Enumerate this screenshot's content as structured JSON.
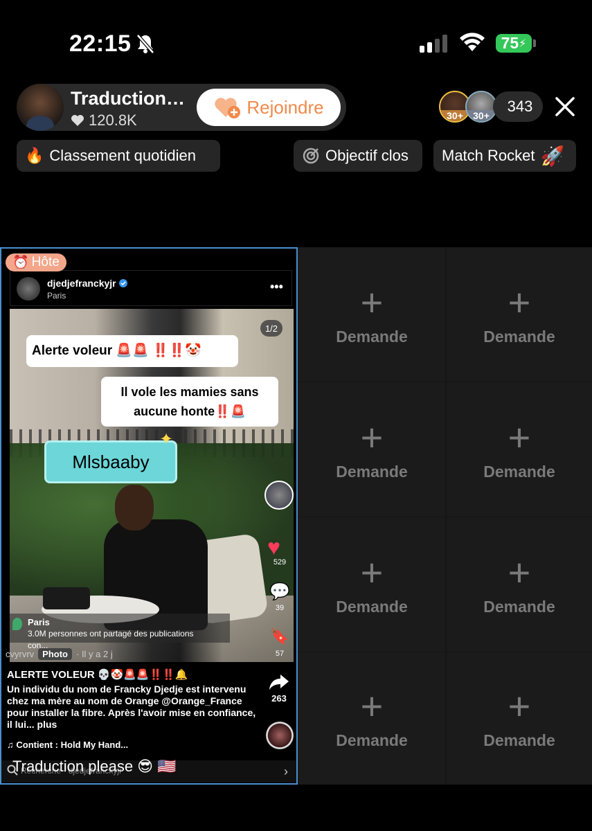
{
  "status": {
    "time": "22:15",
    "battery": "75"
  },
  "host": {
    "name": "Traduction…",
    "likes": "120.8K",
    "join_label": "Rejoindre"
  },
  "viewers": {
    "badge1": "30+",
    "badge2": "30+",
    "count": "343"
  },
  "chips": {
    "ranking": "Classement quotidien",
    "goal": "Objectif clos",
    "rocket": "Match Rocket"
  },
  "host_tile": {
    "badge": "Hôte",
    "post": {
      "username": "djedjefranckyjr",
      "location": "Paris",
      "page_counter": "1/2",
      "bubble1": "Alerte voleur 🚨🚨",
      "bubble1_marks": "‼️‼️🤡",
      "bubble2_line1": "Il vole les mamies sans",
      "bubble2_line2": "aucune honte",
      "bubble2_marks": "‼️🚨",
      "sticker": "Mlsbaaby",
      "likes": "529",
      "comments": "39",
      "saves": "57",
      "shares": "263",
      "place_name": "Paris",
      "place_sub": "3.0M personnes ont partagé des publications con...",
      "username_short": "cvyrvrv",
      "photo_tag": "Photo",
      "time_ago": "· Il y a 2 j",
      "caption_title": "ALERTE VOLEUR 💀🤡🚨🚨‼️‼️🔔",
      "caption_body": "Un individu du nom de Francky Djedje est intervenu chez ma mère au nom de Orange @Orange_France pour installer la fibre. Après l'avoir mise en confiance, il lui... plus",
      "music": "♫ Contient : Hold My Hand...",
      "search_text": "Recherche · djedjefranckyjr"
    },
    "overlay_comment": "Traduction please 😎 🇺🇸"
  },
  "slots": {
    "label": "Demande",
    "plus": "+"
  }
}
